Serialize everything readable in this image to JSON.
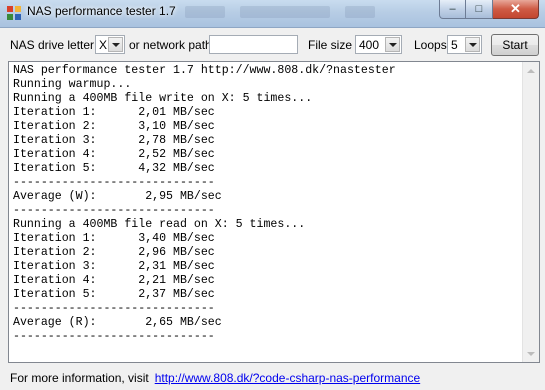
{
  "window": {
    "title": "NAS performance tester 1.7",
    "minimize_glyph": "–",
    "maximize_glyph": "□",
    "close_glyph": "✕"
  },
  "toolbar": {
    "drive_label": "NAS drive letter",
    "drive_value": "X",
    "network_label": "or network path",
    "network_value": "",
    "filesize_label": "File size",
    "filesize_value": "400",
    "loops_label": "Loops",
    "loops_value": "5",
    "start_label": "Start"
  },
  "output": {
    "lines": [
      "NAS performance tester 1.7 http://www.808.dk/?nastester",
      "Running warmup...",
      "Running a 400MB file write on X: 5 times...",
      "Iteration 1:      2,01 MB/sec",
      "Iteration 2:      3,10 MB/sec",
      "Iteration 3:      2,78 MB/sec",
      "Iteration 4:      2,52 MB/sec",
      "Iteration 5:      4,32 MB/sec",
      "-----------------------------",
      "Average (W):       2,95 MB/sec",
      "-----------------------------",
      "Running a 400MB file read on X: 5 times...",
      "Iteration 1:      3,40 MB/sec",
      "Iteration 2:      2,96 MB/sec",
      "Iteration 3:      2,31 MB/sec",
      "Iteration 4:      2,21 MB/sec",
      "Iteration 5:      2,37 MB/sec",
      "-----------------------------",
      "Average (R):       2,65 MB/sec",
      "-----------------------------"
    ]
  },
  "footer": {
    "text": "For more information, visit",
    "link": "http://www.808.dk/?code-csharp-nas-performance"
  },
  "colors": {
    "link": "#0000ee",
    "close_button": "#c24630"
  },
  "icons": [
    "app-icon",
    "minimize-icon",
    "maximize-icon",
    "close-icon",
    "dropdown-arrow-icon",
    "scroll-up-icon",
    "scroll-down-icon"
  ]
}
